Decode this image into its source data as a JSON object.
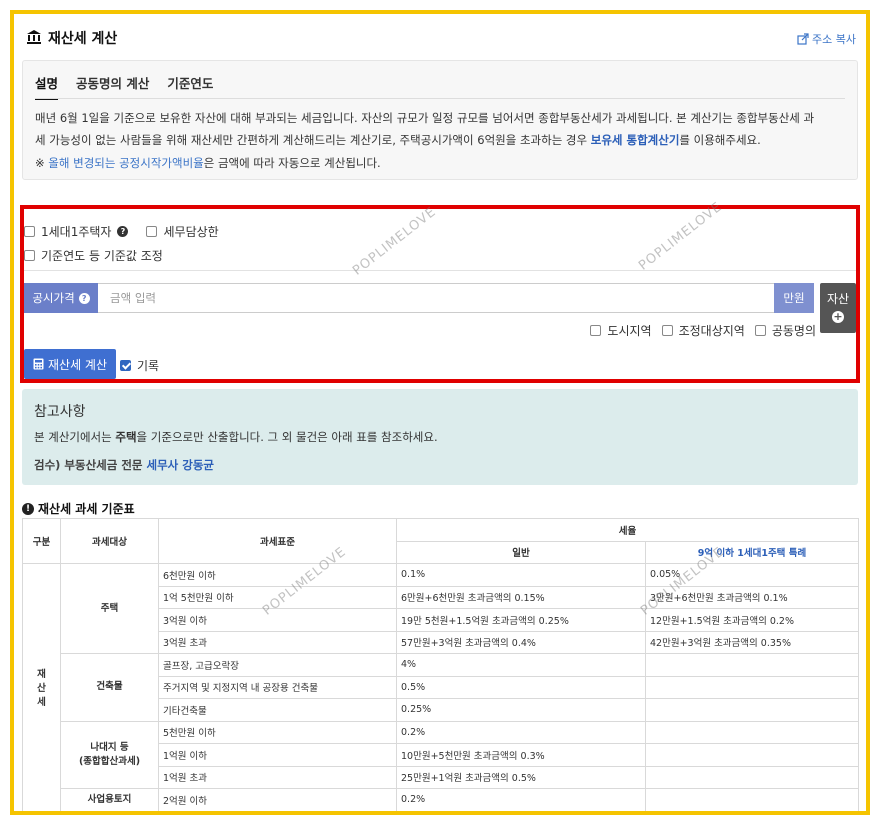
{
  "header": {
    "title": "재산세 계산",
    "copy_label": "주소 복사"
  },
  "tabs": [
    {
      "label": "설명",
      "active": true
    },
    {
      "label": "공동명의 계산",
      "active": false
    },
    {
      "label": "기준연도",
      "active": false
    }
  ],
  "description": {
    "line1": "매년 6월 1일을 기준으로 보유한 자산에 대해 부과되는 세금입니다. 자산의 규모가 일정 규모를 넘어서면 종합부동산세가 과세됩니다. 본 계산기는 종합부동산세 과",
    "line2_a": "세 가능성이 없는 사람들을 위해 재산세만 간편하게 계산해드리는 계산기로, 주택공시가액이 6억원을 초과하는 경우 ",
    "line2_link": "보유세 통합계산기",
    "line2_b": "를 이용해주세요.",
    "note_prefix": "※ ",
    "note_link": "올해 변경되는 공정시작가액비율",
    "note_suffix": "은 금액에 따라 자동으로 계산됩니다."
  },
  "calculator": {
    "chk_one_house": "1세대1주택자",
    "chk_tax_consult": "세무담상한",
    "chk_base_year": "기준연도 등 기준값 조정",
    "price_label": "공시가격",
    "price_placeholder": "금액 입력",
    "unit_label": "만원",
    "asset_label": "자산",
    "opt_city": "도시지역",
    "opt_adjust": "조정대상지역",
    "opt_joint": "공동명의",
    "calc_button": "재산세 계산",
    "record_label": "기록"
  },
  "reference": {
    "title": "참고사항",
    "text_a": "본 계산기에서는 ",
    "text_bold": "주택",
    "text_b": "을 기준으로만 산출합니다. 그 외 물건은 아래 표를 참조하세요.",
    "review_prefix": "검수) 부동산세금 전문 ",
    "review_name": "세무사 강동균"
  },
  "tax_table": {
    "title": "재산세 과세 기준표",
    "headers": {
      "col_type": "구분",
      "col_target": "과세대상",
      "col_base": "과세표준",
      "col_rate": "세율",
      "col_general": "일반",
      "col_special": "9억 이하 1세대1주택 특례"
    },
    "category": "재산세",
    "groups": {
      "housing": "주택",
      "building": "건축물",
      "land_a": "나대지 등",
      "land_b": "(종합합산과세)",
      "separate": "사업용토지"
    },
    "rows": [
      {
        "base": "6천만원 이하",
        "general": "0.1%",
        "special": "0.05%"
      },
      {
        "base": "1억 5천만원 이하",
        "general": "6만원+6천만원 초과금액의 0.15%",
        "special": "3만원+6천만원 초과금액의 0.1%"
      },
      {
        "base": "3억원 이하",
        "general": "19만 5천원+1.5억원 초과금액의 0.25%",
        "special": "12만원+1.5억원 초과금액의 0.2%"
      },
      {
        "base": "3억원 초과",
        "general": "57만원+3억원 초과금액의 0.4%",
        "special": "42만원+3억원 초과금액의 0.35%"
      },
      {
        "base": "골프장, 고급오락장",
        "general": "4%",
        "special": ""
      },
      {
        "base": "주거지역 및 지정지역 내 공장용 건축물",
        "general": "0.5%",
        "special": ""
      },
      {
        "base": "기타건축물",
        "general": "0.25%",
        "special": ""
      },
      {
        "base": "5천만원 이하",
        "general": "0.2%",
        "special": ""
      },
      {
        "base": "1억원 이하",
        "general": "10만원+5천만원 초과금액의 0.3%",
        "special": ""
      },
      {
        "base": "1억원 초과",
        "general": "25만원+1억원 초과금액의 0.5%",
        "special": ""
      },
      {
        "base": "2억원 이하",
        "general": "0.2%",
        "special": ""
      }
    ]
  },
  "watermark": "POPLIMELOVE",
  "colors": {
    "frame": "#f5c400",
    "highlight": "#e00000",
    "accent": "#3f6fd1",
    "link": "#2c5fb8"
  }
}
